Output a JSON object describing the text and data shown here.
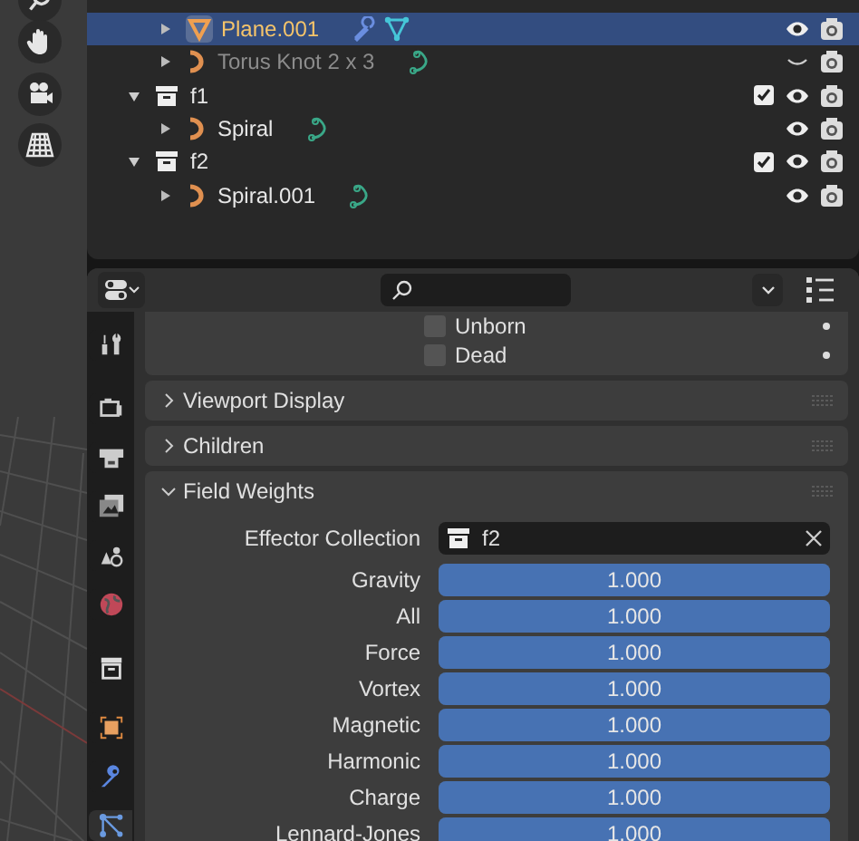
{
  "outliner": {
    "items": [
      {
        "kind": "mesh",
        "name": "Plane.001",
        "selected": true,
        "visible": true
      },
      {
        "kind": "curve",
        "name": "Torus Knot 2 x 3",
        "selected": false,
        "visible": false
      },
      {
        "kind": "collection",
        "name": "f1",
        "expanded": true,
        "checked": true,
        "children": [
          {
            "kind": "curve",
            "name": "Spiral",
            "selected": false,
            "visible": true
          }
        ]
      },
      {
        "kind": "collection",
        "name": "f2",
        "expanded": true,
        "checked": true,
        "children": [
          {
            "kind": "curve",
            "name": "Spiral.001",
            "selected": false,
            "visible": true
          }
        ]
      }
    ]
  },
  "properties": {
    "tabs": [
      {
        "kind": "tool",
        "selected": false
      },
      {
        "kind": "render",
        "selected": false
      },
      {
        "kind": "output",
        "selected": false
      },
      {
        "kind": "view_layer",
        "selected": false
      },
      {
        "kind": "scene",
        "selected": false
      },
      {
        "kind": "world",
        "selected": false
      },
      {
        "kind": "collection",
        "selected": false
      },
      {
        "kind": "object",
        "selected": false
      },
      {
        "kind": "modifier",
        "selected": false
      },
      {
        "kind": "particles",
        "selected": true
      }
    ],
    "checkboxes": [
      {
        "label": "Unborn",
        "checked": false
      },
      {
        "label": "Dead",
        "checked": false
      }
    ],
    "panels": [
      {
        "title": "Viewport Display",
        "expanded": false
      },
      {
        "title": "Children",
        "expanded": false
      },
      {
        "title": "Field Weights",
        "expanded": true,
        "effector_collection": {
          "label": "Effector Collection",
          "value": "f2"
        },
        "weights": [
          {
            "label": "Gravity",
            "value": "1.000",
            "level": 1
          },
          {
            "label": "All",
            "value": "1.000",
            "level": 1
          },
          {
            "label": "Force",
            "value": "1.000",
            "level": 1
          },
          {
            "label": "Vortex",
            "value": "1.000",
            "level": 1
          },
          {
            "label": "Magnetic",
            "value": "1.000",
            "level": 1
          },
          {
            "label": "Harmonic",
            "value": "1.000",
            "level": 1
          },
          {
            "label": "Charge",
            "value": "1.000",
            "level": 1
          },
          {
            "label": "Lennard-Jones",
            "value": "1.000",
            "level": 1
          }
        ]
      }
    ]
  }
}
